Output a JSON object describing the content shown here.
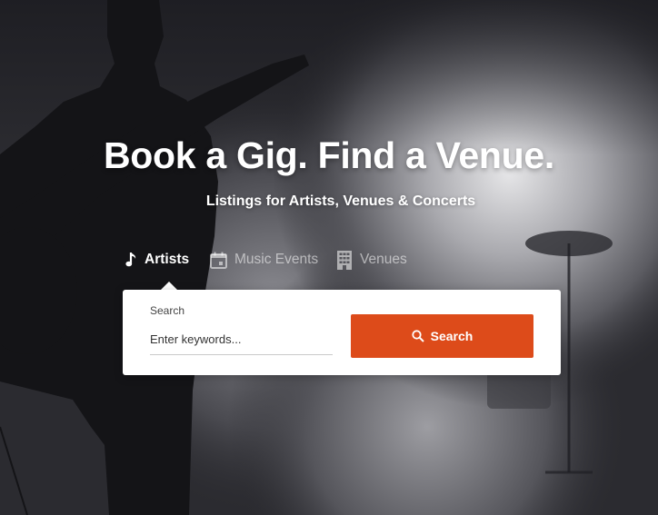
{
  "hero": {
    "title": "Book a Gig. Find a Venue.",
    "subtitle": "Listings for Artists, Venues & Concerts"
  },
  "tabs": [
    {
      "label": "Artists",
      "icon": "music-note-icon",
      "active": true
    },
    {
      "label": "Music Events",
      "icon": "calendar-icon",
      "active": false
    },
    {
      "label": "Venues",
      "icon": "building-icon",
      "active": false
    }
  ],
  "search": {
    "label": "Search",
    "placeholder": "Enter keywords...",
    "button_label": "Search",
    "button_icon": "search-icon"
  },
  "colors": {
    "accent": "#dd4b1a",
    "card": "#ffffff",
    "background": "#2b2b30"
  }
}
